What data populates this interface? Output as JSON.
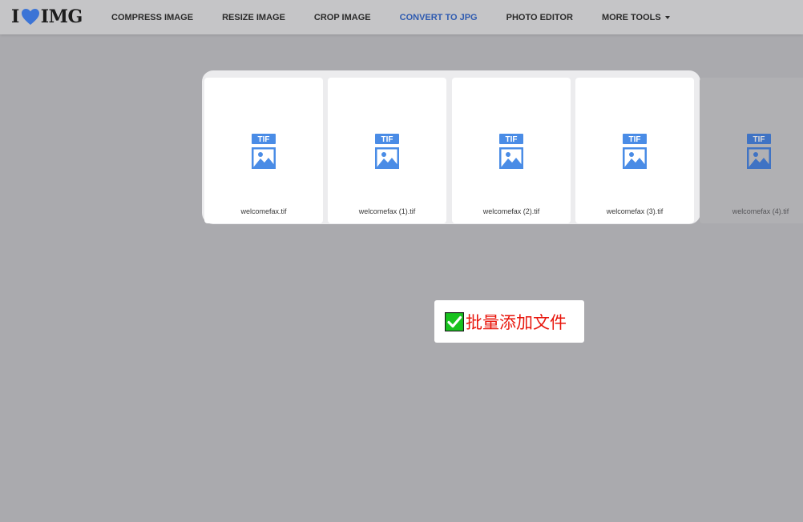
{
  "header": {
    "logo_prefix": "I",
    "logo_suffix": "IMG",
    "nav": [
      {
        "label": "COMPRESS IMAGE"
      },
      {
        "label": "RESIZE IMAGE"
      },
      {
        "label": "CROP IMAGE"
      },
      {
        "label": "CONVERT TO JPG",
        "active": true
      },
      {
        "label": "PHOTO EDITOR"
      },
      {
        "label": "MORE TOOLS"
      }
    ]
  },
  "files": [
    {
      "name": "welcomefax.tif",
      "type_badge": "TIF"
    },
    {
      "name": "welcomefax (1).tif",
      "type_badge": "TIF"
    },
    {
      "name": "welcomefax (2).tif",
      "type_badge": "TIF"
    },
    {
      "name": "welcomefax (3).tif",
      "type_badge": "TIF"
    },
    {
      "name": "welcomefax (4).tif",
      "type_badge": "TIF"
    }
  ],
  "batch_button": {
    "label": "批量添加文件",
    "icon": "check-mark-icon"
  },
  "colors": {
    "page_background": "#aaaaae",
    "header_background": "#c5c5c7",
    "accent_blue": "#2f5bb0",
    "file_icon_blue": "#4a8ce6",
    "logo_heart": "#3b74d6",
    "batch_label_red": "#e8160c",
    "check_green": "#18c21e"
  }
}
